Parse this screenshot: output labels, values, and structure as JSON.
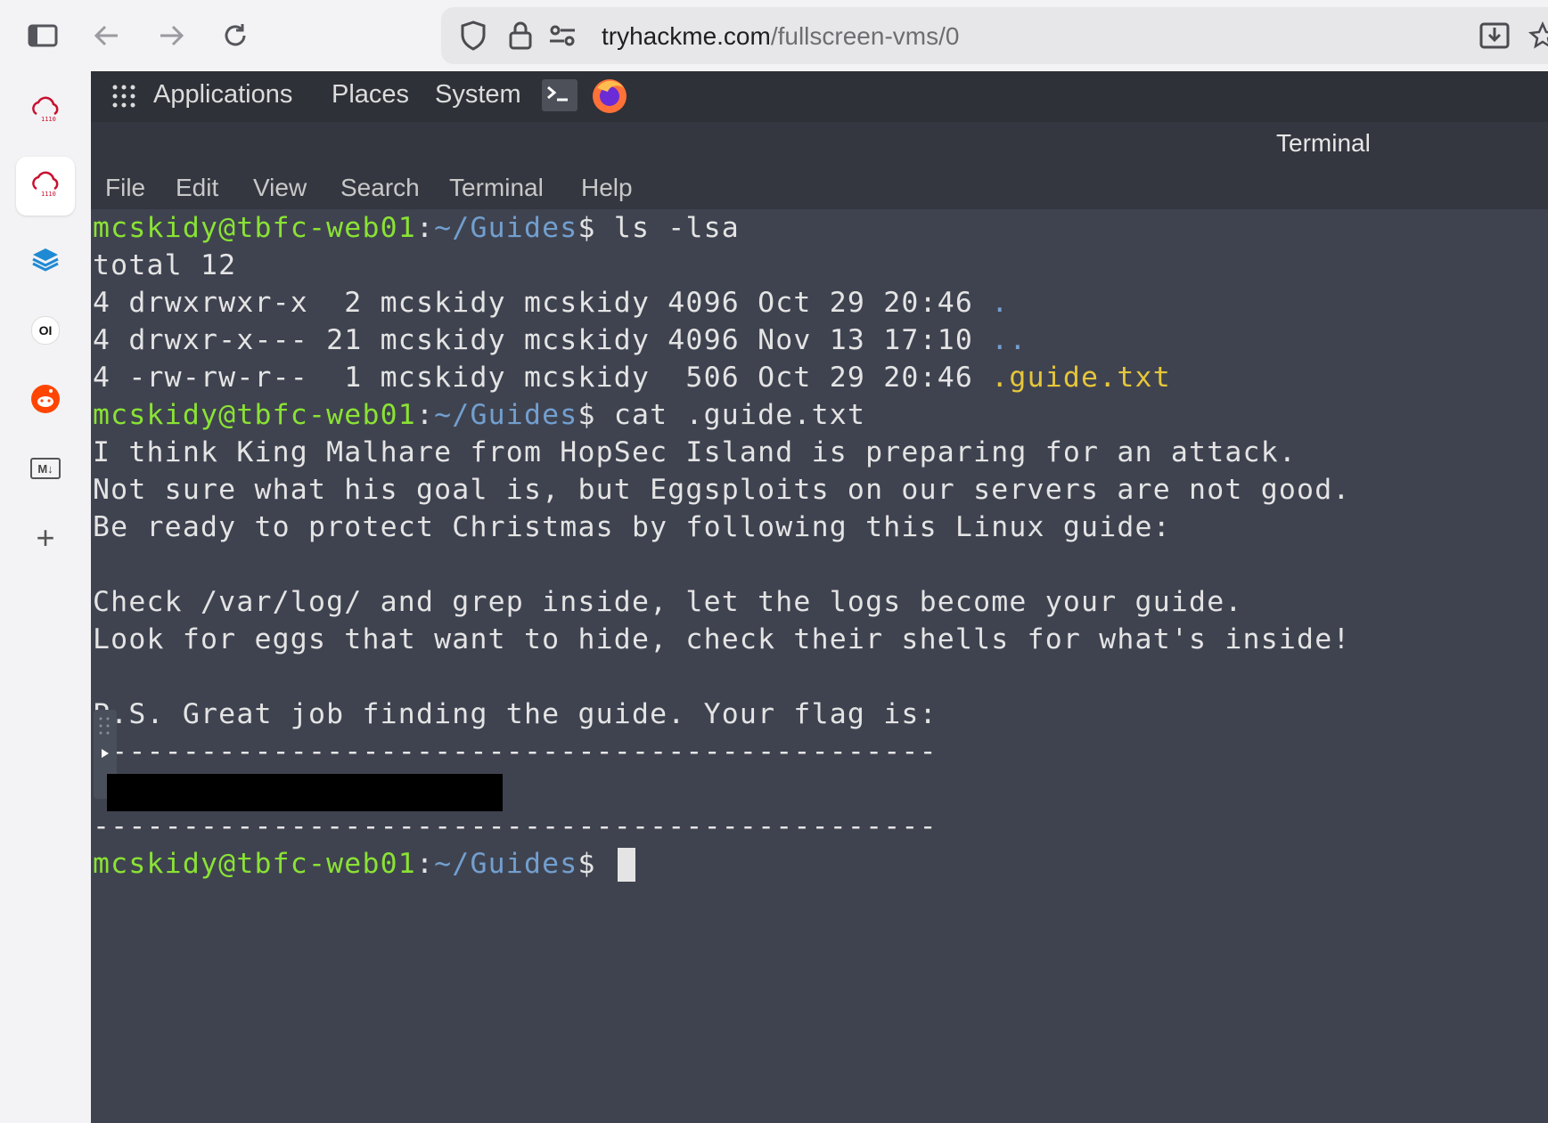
{
  "browser": {
    "url_host": "tryhackme.com",
    "url_path": "/fullscreen-vms/0",
    "icons": [
      "sidebar-toggle-icon",
      "back-arrow-icon",
      "forward-arrow-icon",
      "reload-icon",
      "shield-icon",
      "lock-icon",
      "site-settings-icon",
      "download-icon",
      "bookmark-star-icon"
    ]
  },
  "sidebar": {
    "items": [
      "tryhackme-cloud-icon",
      "tryhackme-cloud-icon-active",
      "stack-layers-icon",
      "openlm-icon",
      "reddit-icon",
      "markdown-icon",
      "add-icon"
    ],
    "openlm_label": "OI",
    "markdown_label": "M↓",
    "add_label": "+"
  },
  "panel": {
    "applications": "Applications",
    "places": "Places",
    "system": "System"
  },
  "terminal": {
    "title": "Terminal",
    "menu": [
      "File",
      "Edit",
      "View",
      "Search",
      "Terminal",
      "Help"
    ],
    "prompt_user": "mcskidy@tbfc-web01",
    "prompt_sep": ":",
    "prompt_path": "~/Guides",
    "prompt_sym": "$ ",
    "cmd1": "ls -lsa",
    "total": "total 12",
    "ls_rows": [
      {
        "text": "4 drwxrwxr-x  2 mcskidy mcskidy 4096 Oct 29 20:46 ",
        "name": "."
      },
      {
        "text": "4 drwxr-x--- 21 mcskidy mcskidy 4096 Nov 13 17:10 ",
        "name": ".."
      },
      {
        "text": "4 -rw-rw-r--  1 mcskidy mcskidy  506 Oct 29 20:46 ",
        "name": ".guide.txt"
      }
    ],
    "cmd2": "cat .guide.txt",
    "guide_lines": [
      "I think King Malhare from HopSec Island is preparing for an attack.",
      "Not sure what his goal is, but Eggsploits on our servers are not good.",
      "Be ready to protect Christmas by following this Linux guide:",
      "",
      "Check /var/log/ and grep inside, let the logs become your guide.",
      "Look for eggs that want to hide, check their shells for what's inside!",
      "",
      "P.S. Great job finding the guide. Your flag is:",
      "-----------------------------------------------",
      "",
      "-----------------------------------------------"
    ]
  },
  "colors": {
    "prompt_user": "#8ae234",
    "prompt_path": "#729fcf",
    "hidden_file": "#e6c63a",
    "terminal_bg": "#3f4350"
  }
}
